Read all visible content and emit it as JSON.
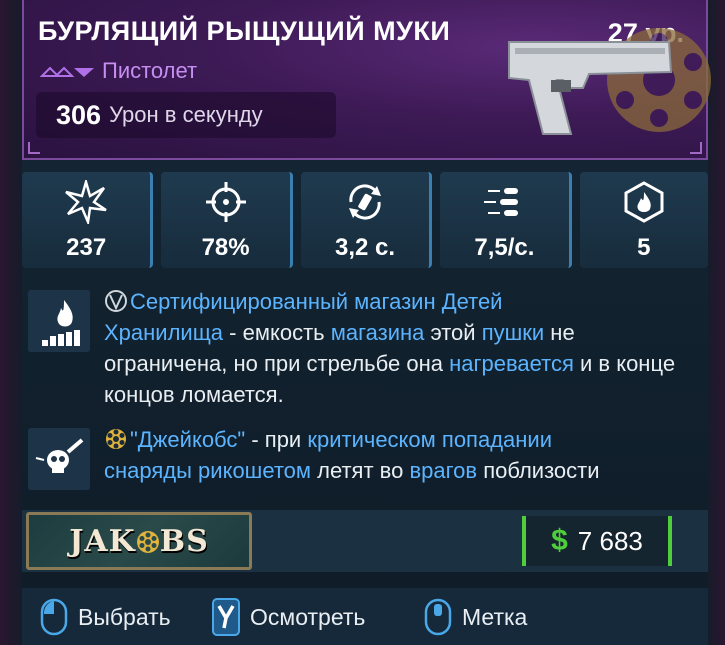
{
  "header": {
    "title": "БУРЛЯЩИЙ РЫЩУЩИЙ МУКИ",
    "level": "27 ур.",
    "weapon_type": "Пистолет",
    "dps_value": "306",
    "dps_label": "Урон в секунду",
    "rarity_color": "#a04ae0"
  },
  "stats": [
    {
      "icon": "damage-burst-icon",
      "value": "237"
    },
    {
      "icon": "accuracy-crosshair-icon",
      "value": "78%"
    },
    {
      "icon": "reload-time-icon",
      "value": "3,2 с."
    },
    {
      "icon": "fire-rate-bullets-icon",
      "value": "7,5/с."
    },
    {
      "icon": "elemental-fire-icon",
      "value": "5"
    }
  ],
  "perks": [
    {
      "icon": "heat-fire-icon",
      "parts": {
        "p1": "Сертифицированный магазин Детей",
        "p2": "Хранилища",
        "p3": " - емкость ",
        "p4": "магазина",
        "p5": " этой ",
        "p6": "пушки",
        "p7": " не ограничена, но при стрельбе она ",
        "p8": "нагревается",
        "p9": " и в конце концов ломается."
      }
    },
    {
      "icon": "jakobs-skull-icon",
      "parts": {
        "p1": "\"Джейкобс\"",
        "p2": " - при ",
        "p3": "критическом попадании",
        "p4": "снаряды рикошетом",
        "p5": " летят во ",
        "p6": "врагов",
        "p7": " поблизости"
      }
    }
  ],
  "maker": {
    "name_left": "JAK",
    "name_right": "BS"
  },
  "price": {
    "currency": "$",
    "value": "7 683",
    "color": "#4fce3c"
  },
  "actions": [
    {
      "label": "Выбрать",
      "icon": "mouse-left-icon"
    },
    {
      "label": "Осмотреть",
      "key": "Y"
    },
    {
      "label": "Метка",
      "icon": "mouse-middle-icon"
    }
  ],
  "colors": {
    "highlight": "#5cb4ff",
    "accent_blue": "#3a7fb0",
    "purple_header": "#3d1a55"
  }
}
